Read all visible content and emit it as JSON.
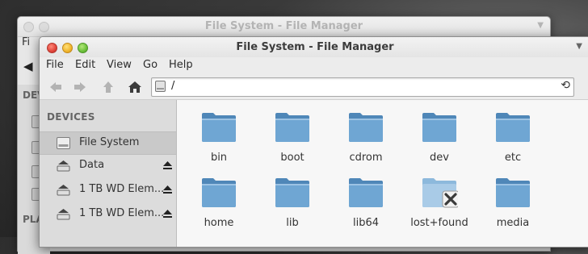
{
  "background_window": {
    "title": "File System - File Manager",
    "menu_first": "Fi",
    "side_header": "DEVI",
    "places_header": "PLA"
  },
  "window": {
    "title": "File System - File Manager"
  },
  "menu": [
    "File",
    "Edit",
    "View",
    "Go",
    "Help"
  ],
  "toolbar": {
    "path": "/"
  },
  "sidebar": {
    "devices_header": "DEVICES",
    "items": [
      {
        "label": "File System",
        "icon": "hard-drive-icon",
        "selected": true,
        "eject": false
      },
      {
        "label": "Data",
        "icon": "removable-drive-icon",
        "selected": false,
        "eject": true
      },
      {
        "label": "1 TB WD Elem...",
        "icon": "removable-drive-icon",
        "selected": false,
        "eject": true
      },
      {
        "label": "1 TB WD Elem...",
        "icon": "removable-drive-icon",
        "selected": false,
        "eject": true
      }
    ]
  },
  "files": [
    {
      "name": "bin",
      "icon": "folder-icon"
    },
    {
      "name": "boot",
      "icon": "folder-icon"
    },
    {
      "name": "cdrom",
      "icon": "folder-icon"
    },
    {
      "name": "dev",
      "icon": "folder-icon"
    },
    {
      "name": "etc",
      "icon": "folder-icon"
    },
    {
      "name": "home",
      "icon": "folder-icon"
    },
    {
      "name": "lib",
      "icon": "folder-icon"
    },
    {
      "name": "lib64",
      "icon": "folder-icon"
    },
    {
      "name": "lost+found",
      "icon": "locked-folder-icon"
    },
    {
      "name": "media",
      "icon": "folder-icon"
    }
  ],
  "colors": {
    "folder": "#6fa6d3",
    "folder_dark": "#4f87b8",
    "sidebar_bg": "#dcdcdc",
    "view_bg": "#f7f7f7"
  }
}
